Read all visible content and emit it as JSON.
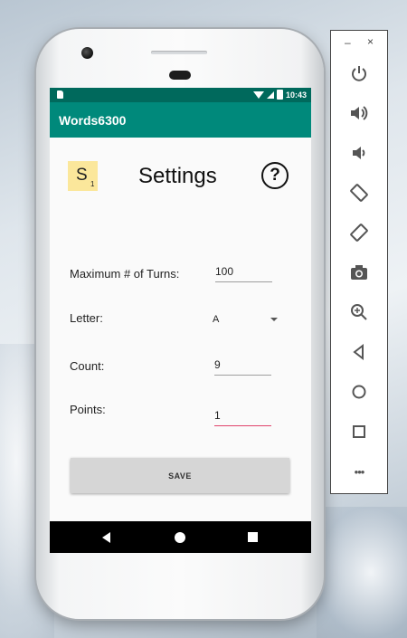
{
  "statusbar": {
    "time": "10:43"
  },
  "app": {
    "title": "Words6300"
  },
  "settings": {
    "title": "Settings",
    "tile_letter": "S",
    "tile_points": "1",
    "help_glyph": "?",
    "max_turns_label": "Maximum # of Turns:",
    "max_turns_value": "100",
    "letter_label": "Letter:",
    "letter_value": "A",
    "count_label": "Count:",
    "count_value": "9",
    "points_label": "Points:",
    "points_value": "1",
    "save_label": "SAVE"
  },
  "emulator": {
    "minimize": "–",
    "close": "×",
    "more": "•••",
    "buttons": [
      "power-icon",
      "volume-up-icon",
      "volume-down-icon",
      "rotate-left-icon",
      "rotate-right-icon",
      "camera-icon",
      "zoom-icon",
      "back-icon",
      "home-icon",
      "overview-icon",
      "more-icon"
    ]
  },
  "colors": {
    "primary": "#00897b",
    "primary_dark": "#00695c",
    "accent": "#e0436b",
    "tile": "#fbe79b"
  }
}
